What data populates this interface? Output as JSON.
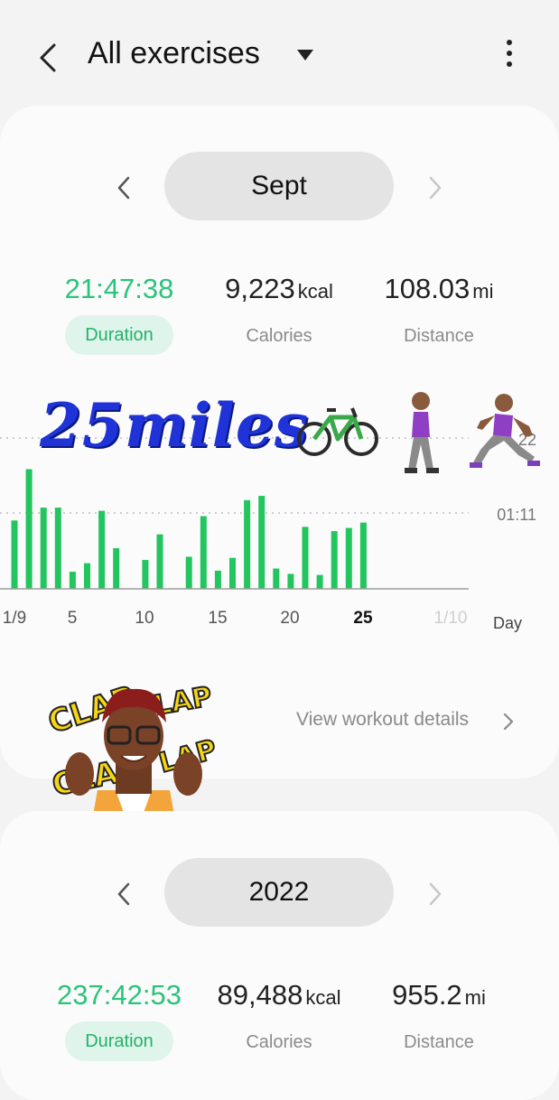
{
  "header": {
    "title": "All exercises"
  },
  "month_card": {
    "period": "Sept",
    "stats": {
      "duration": {
        "value": "21:47:38",
        "label": "Duration"
      },
      "calories": {
        "value": "9,223",
        "unit": "kcal",
        "label": "Calories"
      },
      "distance": {
        "value": "108.03",
        "unit": "mi",
        "label": "Distance"
      }
    },
    "sticker_text": "25miles",
    "details_link": "View workout details"
  },
  "year_card": {
    "period": "2022",
    "stats": {
      "duration": {
        "value": "237:42:53",
        "label": "Duration"
      },
      "calories": {
        "value": "89,488",
        "unit": "kcal",
        "label": "Calories"
      },
      "distance": {
        "value": "955.2",
        "unit": "mi",
        "label": "Distance"
      }
    }
  },
  "chart_data": {
    "type": "bar",
    "x": [
      1,
      2,
      3,
      4,
      5,
      6,
      7,
      8,
      9,
      10,
      11,
      12,
      13,
      14,
      15,
      16,
      17,
      18,
      19,
      20,
      21,
      22,
      23,
      24,
      25
    ],
    "values_minutes": [
      64,
      112,
      76,
      76,
      16,
      24,
      73,
      38,
      0,
      27,
      51,
      0,
      30,
      68,
      17,
      29,
      83,
      87,
      19,
      14,
      58,
      13,
      54,
      57,
      62
    ],
    "x_tick_labels": [
      "1/9",
      "5",
      "10",
      "15",
      "20",
      "25",
      "1/10"
    ],
    "x_unit_label": "Day",
    "y_tick_labels": [
      "22",
      "01:11"
    ],
    "highlight_label": "25",
    "bar_color": "#22c55e"
  },
  "colors": {
    "accent": "#2ac47a",
    "bar": "#22c55e",
    "card": "#fbfbfb",
    "background": "#f3f3f3"
  }
}
